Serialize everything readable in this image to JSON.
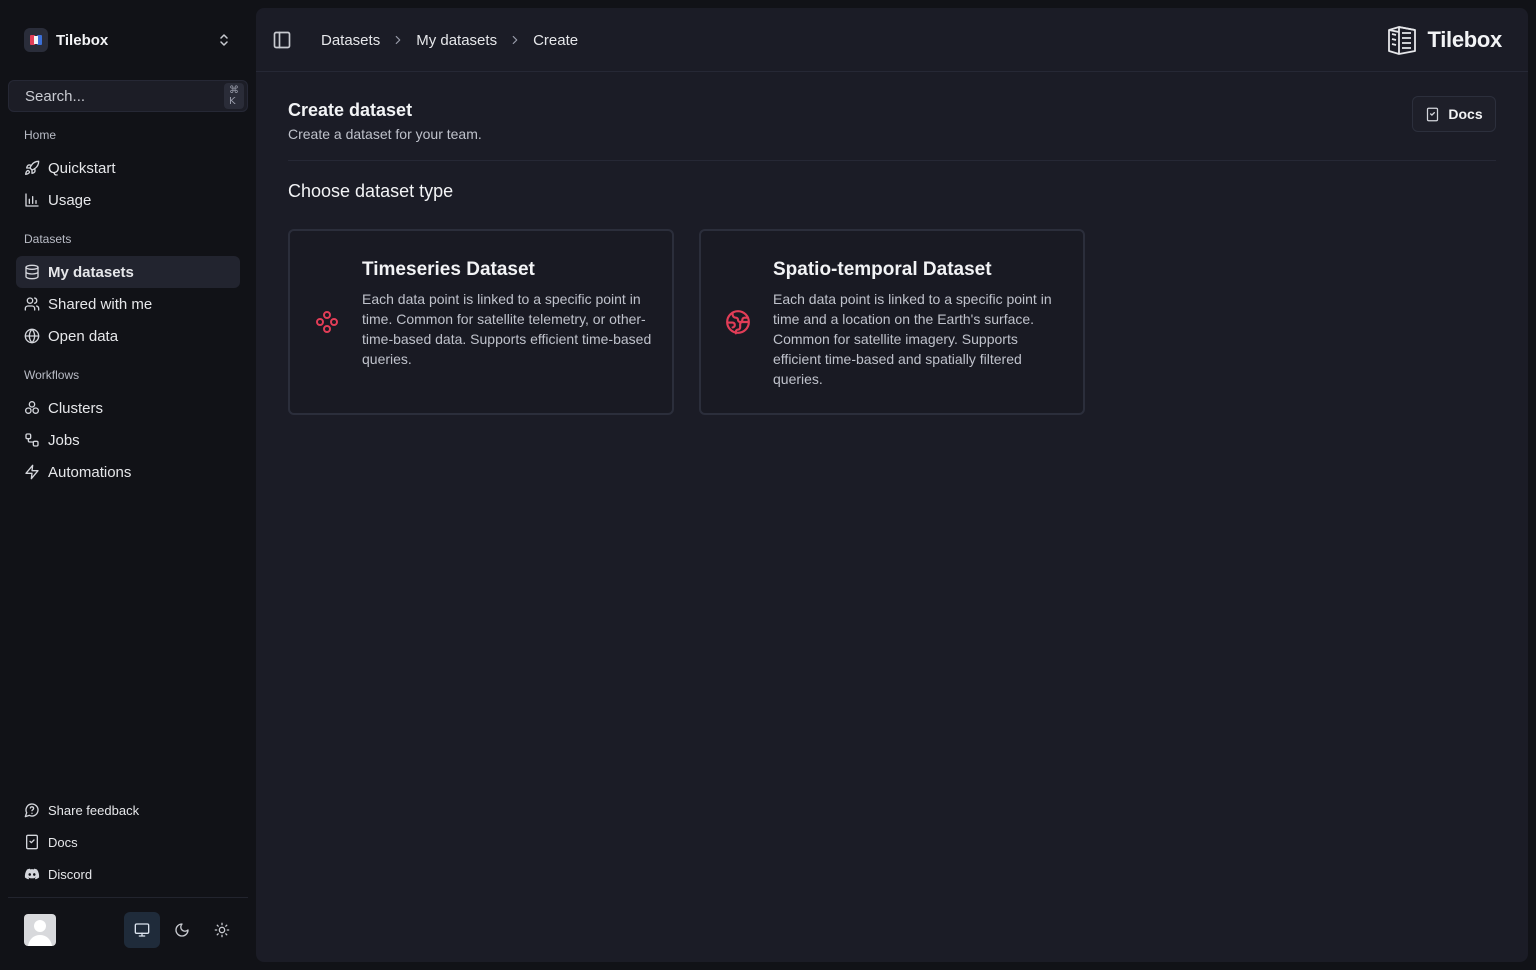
{
  "sidebar": {
    "team_name": "Tilebox",
    "search": {
      "placeholder": "Search...",
      "shortcut": "⌘ K"
    },
    "sections": {
      "home": "Home",
      "datasets": "Datasets",
      "workflows": "Workflows"
    },
    "items": {
      "quickstart": "Quickstart",
      "usage": "Usage",
      "my_datasets": "My datasets",
      "shared_with_me": "Shared with me",
      "open_data": "Open data",
      "clusters": "Clusters",
      "jobs": "Jobs",
      "automations": "Automations"
    },
    "footer": {
      "share_feedback": "Share feedback",
      "docs": "Docs",
      "discord": "Discord"
    },
    "theme_selected": "system"
  },
  "header": {
    "breadcrumbs": [
      "Datasets",
      "My datasets",
      "Create"
    ],
    "brand": "Tilebox"
  },
  "page": {
    "title": "Create dataset",
    "subtitle": "Create a dataset for your team.",
    "docs_button": "Docs",
    "section_title": "Choose dataset type",
    "cards": [
      {
        "title": "Timeseries Dataset",
        "description": "Each data point is linked to a specific point in time. Common for satellite telemetry, or other-time-based data. Supports efficient time-based queries."
      },
      {
        "title": "Spatio-temporal Dataset",
        "description": "Each data point is linked to a specific point in time and a location on the Earth's surface. Common for satellite imagery. Supports efficient time-based and spatially filtered queries."
      }
    ]
  },
  "colors": {
    "accent": "#e23d57",
    "background": "#111217",
    "panel": "#1b1c26"
  }
}
